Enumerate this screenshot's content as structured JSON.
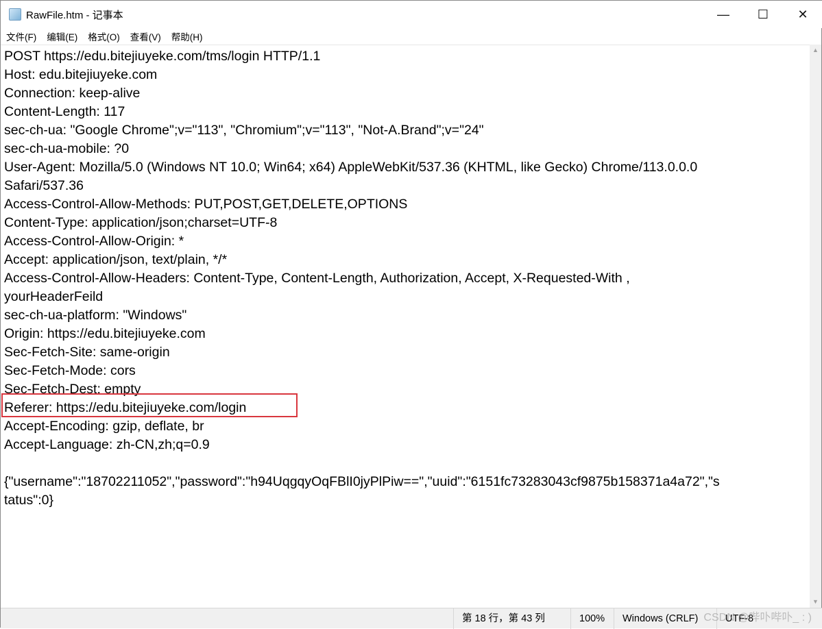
{
  "window": {
    "title": "RawFile.htm - 记事本",
    "minimize": "—",
    "maximize": "☐",
    "close": "✕"
  },
  "menu": [
    "文件(F)",
    "编辑(E)",
    "格式(O)",
    "查看(V)",
    "帮助(H)"
  ],
  "lines": [
    "POST https://edu.bitejiuyeke.com/tms/login HTTP/1.1",
    "Host: edu.bitejiuyeke.com",
    "Connection: keep-alive",
    "Content-Length: 117",
    "sec-ch-ua: \"Google Chrome\";v=\"113\", \"Chromium\";v=\"113\", \"Not-A.Brand\";v=\"24\"",
    "sec-ch-ua-mobile: ?0",
    "User-Agent: Mozilla/5.0 (Windows NT 10.0; Win64; x64) AppleWebKit/537.36 (KHTML, like Gecko) Chrome/113.0.0.0",
    "Safari/537.36",
    "Access-Control-Allow-Methods: PUT,POST,GET,DELETE,OPTIONS",
    "Content-Type: application/json;charset=UTF-8",
    "Access-Control-Allow-Origin: *",
    "Accept: application/json, text/plain, */*",
    "Access-Control-Allow-Headers: Content-Type, Content-Length, Authorization, Accept, X-Requested-With ,",
    "yourHeaderFeild",
    "sec-ch-ua-platform: \"Windows\"",
    "Origin: https://edu.bitejiuyeke.com",
    "Sec-Fetch-Site: same-origin",
    "Sec-Fetch-Mode: cors",
    "Sec-Fetch-Dest: empty",
    "Referer: https://edu.bitejiuyeke.com/login",
    "Accept-Encoding: gzip, deflate, br",
    "Accept-Language: zh-CN,zh;q=0.9",
    "",
    "{\"username\":\"18702211052\",\"password\":\"h94UqgqyOqFBlI0jyPlPiw==\",\"uuid\":\"6151fc73283043cf9875b158371a4a72\",\"s",
    "tatus\":0}"
  ],
  "status": {
    "position": "第 18 行，第 43 列",
    "zoom": "100%",
    "line_ending": "Windows (CRLF)",
    "encoding": "UTF-8"
  },
  "watermark": "CSDN @哔卟哔卟_ : )",
  "highlight_color": "#d9363e"
}
